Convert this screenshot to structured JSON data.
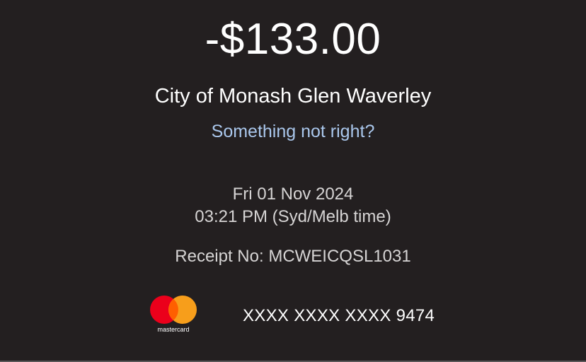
{
  "transaction": {
    "amount": "-$133.00",
    "merchant": "City of Monash Glen Waverley",
    "help_link": "Something not right?",
    "date": "Fri 01 Nov 2024",
    "time": "03:21 PM (Syd/Melb time)",
    "receipt": "Receipt No: MCWEICQSL1031"
  },
  "card": {
    "brand_logo_text": "mastercard",
    "number": "XXXX XXXX XXXX 9474",
    "brand_colors": {
      "red": "#eb001b",
      "orange": "#f79e1b",
      "overlap": "#ff5f00"
    }
  },
  "theme": {
    "background": "#231f20",
    "link_color": "#aac7ec"
  }
}
